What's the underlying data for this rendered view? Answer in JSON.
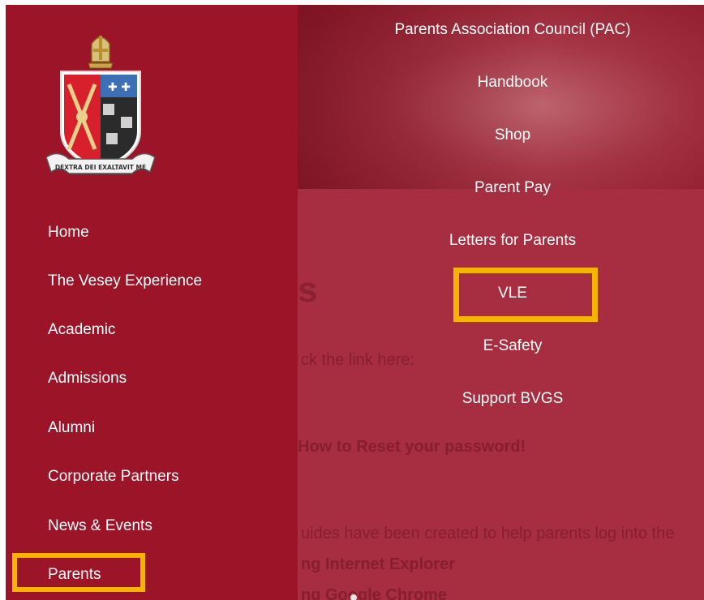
{
  "sidebar": {
    "crest": {
      "motto": "DEXTRA DEI EXALTAVIT ME"
    },
    "items": [
      {
        "label": "Home"
      },
      {
        "label": "The Vesey Experience"
      },
      {
        "label": "Academic"
      },
      {
        "label": "Admissions"
      },
      {
        "label": "Alumni"
      },
      {
        "label": "Corporate Partners"
      },
      {
        "label": "News & Events"
      },
      {
        "label": "Parents",
        "highlighted": true
      }
    ]
  },
  "submenu": {
    "items": [
      {
        "label": "Parents Association Council (PAC)"
      },
      {
        "label": "Handbook"
      },
      {
        "label": "Shop"
      },
      {
        "label": "Parent Pay"
      },
      {
        "label": "Letters for Parents"
      },
      {
        "label": "VLE",
        "highlighted": true
      },
      {
        "label": "E-Safety"
      },
      {
        "label": "Support BVGS"
      }
    ]
  },
  "background_content": {
    "heading_fragment": "s",
    "link_text": "ck the link here:",
    "reset_text": "How to Reset your password!",
    "guides_text": "uides have been created to help parents log into the",
    "ie_text": "ng Internet Explorer",
    "chrome_text": "ng Google Chrome"
  },
  "colors": {
    "sidebar_bg": "#9b1428",
    "overlay_bg": "#a62e40",
    "highlight": "#f5b400",
    "text": "#ffffff"
  }
}
